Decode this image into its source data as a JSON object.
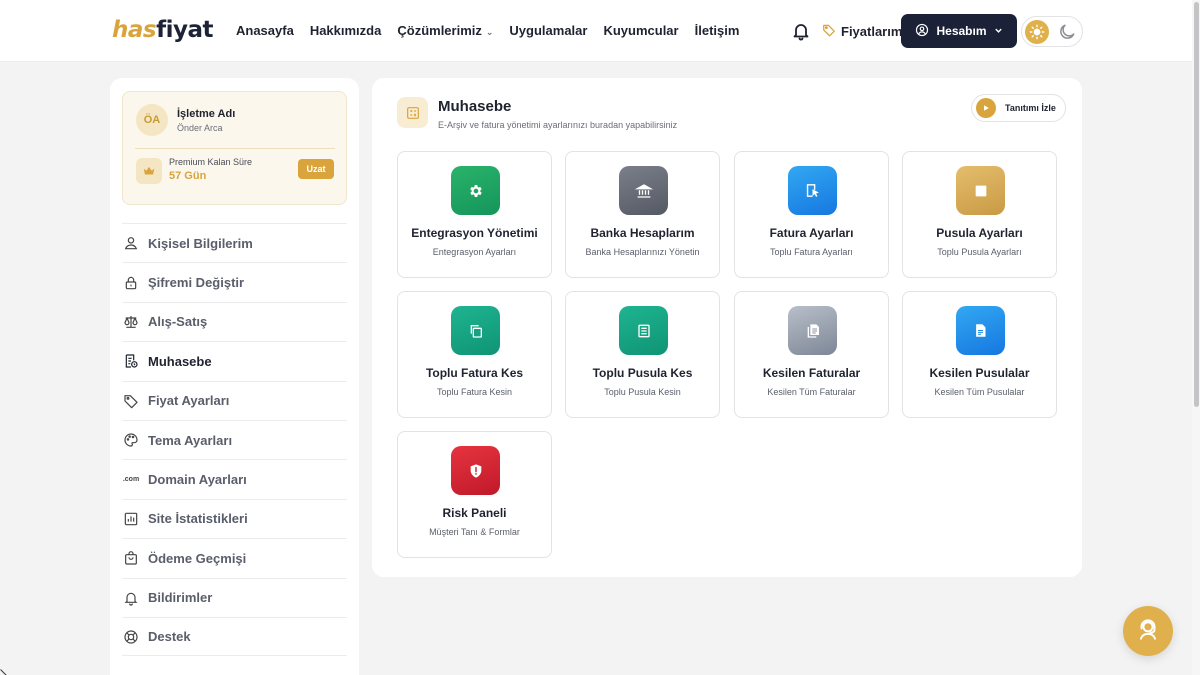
{
  "header": {
    "logo_part1": "has",
    "logo_part2": "fiyat",
    "nav": [
      {
        "label": "Anasayfa"
      },
      {
        "label": "Hakkımızda"
      },
      {
        "label": "Çözümlerimiz",
        "dropdown": true
      },
      {
        "label": "Uygulamalar"
      },
      {
        "label": "Kuyumcular"
      },
      {
        "label": "İletişim"
      }
    ],
    "prices_label": "Fiyatlarım",
    "account_label": "Hesabım",
    "theme": "light"
  },
  "sidebar": {
    "profile": {
      "initials": "ÖA",
      "business_name": "İşletme Adı",
      "owner_name": "Önder Arca",
      "premium_label": "Premium Kalan Süre",
      "premium_days": "57 Gün",
      "extend_label": "Uzat"
    },
    "menu": [
      {
        "label": "Kişisel Bilgilerim",
        "icon": "user-icon"
      },
      {
        "label": "Şifremi Değiştir",
        "icon": "lock-icon"
      },
      {
        "label": "Alış-Satış",
        "icon": "scale-icon"
      },
      {
        "label": "Muhasebe",
        "icon": "receipt-icon",
        "active": true
      },
      {
        "label": "Fiyat Ayarları",
        "icon": "tag-icon"
      },
      {
        "label": "Tema Ayarları",
        "icon": "palette-icon"
      },
      {
        "label": "Domain Ayarları",
        "icon": "com-icon",
        "icon_text": ".com"
      },
      {
        "label": "Site İstatistikleri",
        "icon": "bar-chart-icon"
      },
      {
        "label": "Ödeme Geçmişi",
        "icon": "shopping-bag-icon"
      },
      {
        "label": "Bildirimler",
        "icon": "bell-icon"
      },
      {
        "label": "Destek",
        "icon": "lifebuoy-icon"
      }
    ]
  },
  "main": {
    "title": "Muhasebe",
    "subtitle": "E-Arşiv ve fatura yönetimi ayarlarınızı buradan yapabilirsiniz",
    "watch_label": "Tanıtımı İzle",
    "cards": [
      {
        "title": "Entegrasyon Yönetimi",
        "subtitle": "Entegrasyon Ayarları",
        "icon": "gear-icon",
        "color_from": "#2ab36b",
        "color_to": "#14955a"
      },
      {
        "title": "Banka Hesaplarım",
        "subtitle": "Banka Hesaplarınızı Yönetin",
        "icon": "bank-icon",
        "color_from": "#7a7f8a",
        "color_to": "#545964"
      },
      {
        "title": "Fatura Ayarları",
        "subtitle": "Toplu Fatura Ayarları",
        "icon": "invoice-settings-icon",
        "color_from": "#32a8f2",
        "color_to": "#1677e0"
      },
      {
        "title": "Pusula Ayarları",
        "subtitle": "Toplu Pusula Ayarları",
        "icon": "square-icon",
        "color_from": "#e4bd6c",
        "color_to": "#c99a45"
      },
      {
        "title": "Toplu Fatura Kes",
        "subtitle": "Toplu Fatura Kesin",
        "icon": "copy-icon",
        "color_from": "#1fb491",
        "color_to": "#0f9474"
      },
      {
        "title": "Toplu Pusula Kes",
        "subtitle": "Toplu Pusula Kesin",
        "icon": "list-document-icon",
        "color_from": "#1fb491",
        "color_to": "#0f9474"
      },
      {
        "title": "Kesilen Faturalar",
        "subtitle": "Kesilen Tüm Faturalar",
        "icon": "document-icon",
        "color_from": "#b8bfca",
        "color_to": "#7e8796"
      },
      {
        "title": "Kesilen Pusulalar",
        "subtitle": "Kesilen Tüm Pusulalar",
        "icon": "file-text-icon",
        "color_from": "#32a8f2",
        "color_to": "#1677e0"
      },
      {
        "title": "Risk Paneli",
        "subtitle": "Müşteri Tanı & Formlar",
        "icon": "shield-alert-icon",
        "color_from": "#e6343f",
        "color_to": "#c0192a"
      }
    ]
  },
  "support_icon": "support-agent-icon"
}
